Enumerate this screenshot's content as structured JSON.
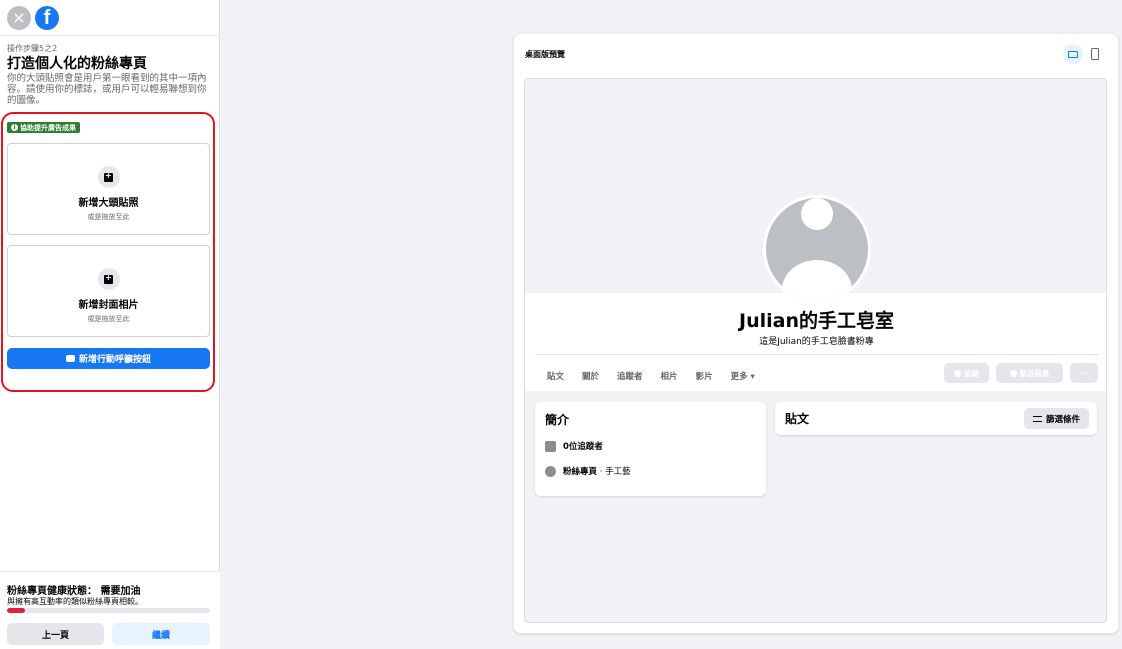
{
  "sidebar": {
    "close_icon": "×",
    "step": "操作步驟5之2",
    "title": "打造個人化的粉絲專頁",
    "description": "你的大頭貼照會是用戶第一眼看到的其中一項內容。請使用你的標誌，或用戶可以輕易聯想到你的圖像。",
    "badge": "協助提升廣告成果",
    "profile_upload": {
      "title": "新增大頭貼照",
      "sub": "或是拖放至此"
    },
    "cover_upload": {
      "title": "新增封面相片",
      "sub": "或是拖放至此"
    },
    "cta_button": "新增行動呼籲按鈕",
    "health_title": "粉絲專頁健康狀態： 需要加油",
    "health_sub": "與擁有高互動率的類似粉絲專頁相較。",
    "health_progress": 0.09,
    "prev_button": "上一頁",
    "next_button": "繼續"
  },
  "preview": {
    "card_title": "桌面版預覽",
    "page_name": "Julian的手工皂室",
    "page_sub": "這是Julian的手工皂臉書粉專",
    "tabs": [
      "貼文",
      "關於",
      "追蹤者",
      "相片",
      "影片",
      "更多 ▾"
    ],
    "follow_button": "追蹤",
    "message_button": "發送訊息",
    "more_button": "···",
    "intro_title": "簡介",
    "followers": "0位追蹤者",
    "page_type_label": "粉絲專頁",
    "page_type_value": " · 手工藝",
    "posts_title": "貼文",
    "filter_button": "篩選條件"
  },
  "colors": {
    "brand": "#1877f2",
    "highlight": "#e0161d",
    "badge": "#2e7d32"
  }
}
